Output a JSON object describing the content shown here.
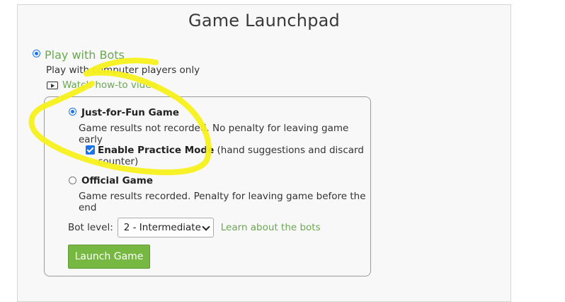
{
  "page": {
    "title": "Game Launchpad"
  },
  "bots_option": {
    "label": "Play with Bots",
    "description": "Play with computer players only",
    "video_link": "Watch how-to video",
    "video_icon": "video-play-icon",
    "selected": true
  },
  "modes": {
    "fun": {
      "title": "Just-for-Fun Game",
      "description": "Game results not recorded. No penalty for leaving game early",
      "selected": true
    },
    "practice": {
      "label": "Enable Practice Mode",
      "suffix": " (hand suggestions and discard counter)",
      "checked": true
    },
    "official": {
      "title": "Official Game",
      "description": "Game results recorded. Penalty for leaving game before the end",
      "selected": false
    }
  },
  "bot_level": {
    "label": "Bot level:",
    "selected": "2 - Intermediate",
    "learn_link": "Learn about the bots"
  },
  "launch_button": "Launch Game",
  "colors": {
    "accent_green": "#6aa84f",
    "button_green": "#77b843",
    "radio_blue": "#1a73e8",
    "annotation_yellow": "#f7f01c"
  }
}
